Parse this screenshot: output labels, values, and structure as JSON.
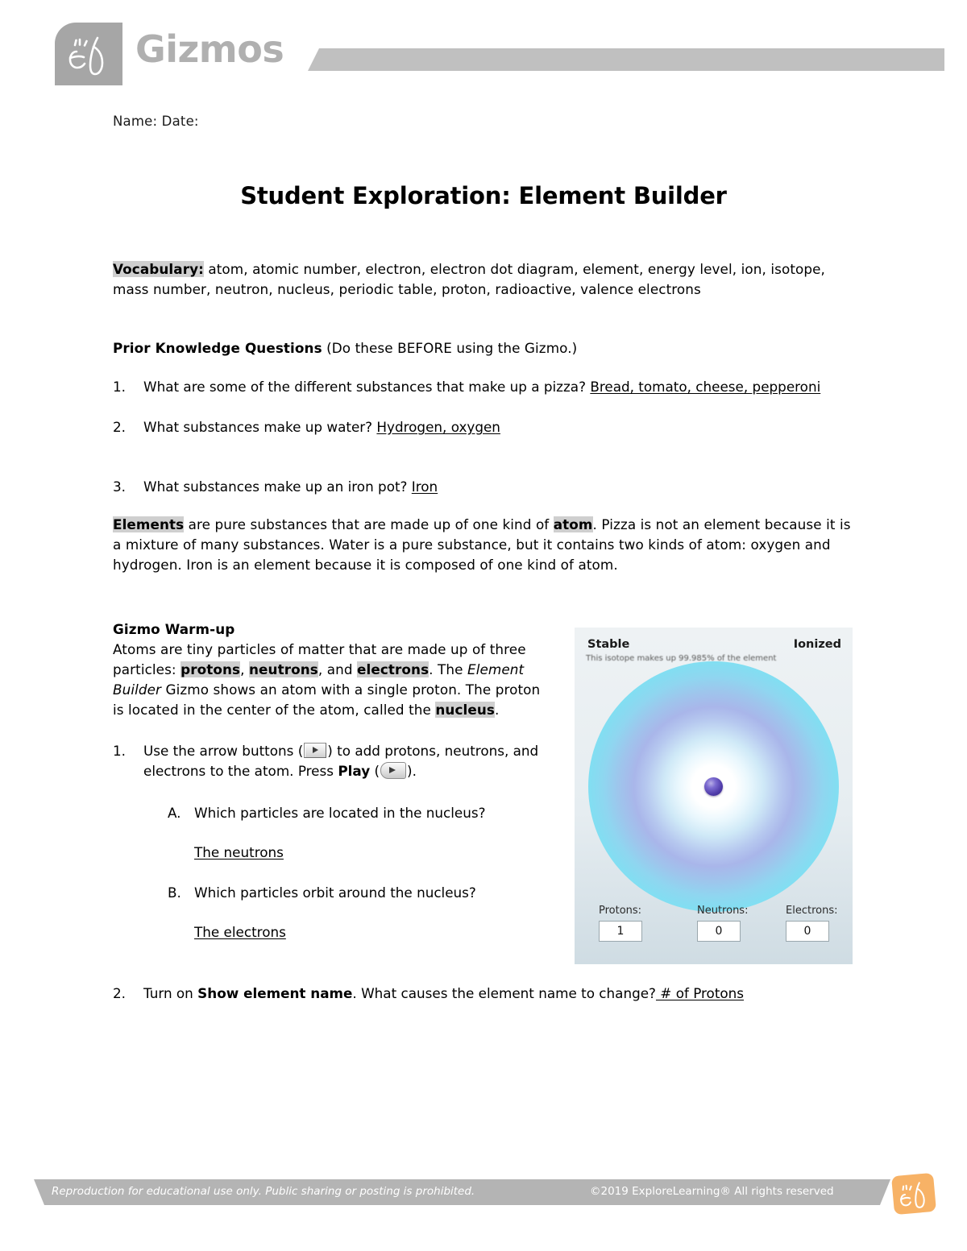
{
  "header": {
    "logo_alt": "ExploreLearning el monogram",
    "wordmark": "Gizmos"
  },
  "document": {
    "name_date_line": "Name: Date:",
    "title": "Student Exploration: Element Builder",
    "vocabulary": {
      "label": "Vocabulary:",
      "terms": " atom, atomic number, electron, electron dot diagram, element, energy level, ion, isotope, mass number, neutron, nucleus, periodic table, proton, radioactive, valence electrons"
    },
    "prior_knowledge": {
      "heading": "Prior Knowledge Questions",
      "heading_note": " (Do these BEFORE using the Gizmo.)",
      "questions": [
        {
          "num": "1.",
          "text": "What are some of the different substances that make up a pizza? ",
          "answer": "Bread, tomato, cheese, pepperoni "
        },
        {
          "num": "2.",
          "text": "What substances make up water? ",
          "answer": "Hydrogen, oxygen"
        },
        {
          "num": "3.",
          "text": "What substances make up an iron pot? ",
          "answer": "Iron"
        }
      ]
    },
    "elements_paragraph": {
      "term_elements": "Elements",
      "part1": " are pure substances that are made up of one kind of ",
      "term_atom": "atom",
      "part2": ". Pizza is not an element because it is a mixture of many substances. Water is a pure substance, but it contains two kinds of atom: oxygen and hydrogen. Iron is an element because it is composed of one kind of atom."
    },
    "warmup": {
      "heading": "Gizmo Warm-up",
      "part1": "Atoms are tiny particles of matter that are made up of three particles: ",
      "term_protons": "protons",
      "sep1": ", ",
      "term_neutrons": "neutrons",
      "sep2": ", and ",
      "term_electrons": "electrons",
      "part2": ". The ",
      "gizmo_name": "Element Builder",
      "part3": " Gizmo shows an atom with a single proton. The proton is located in the center of the atom, called the ",
      "term_nucleus": "nucleus",
      "part4": "."
    },
    "warmup_questions": [
      {
        "num": "1.",
        "text_a": "Use the arrow buttons (",
        "icon_arrow": "arrow-button-icon",
        "text_b": ") to add protons, neutrons, and electrons to the atom. Press ",
        "play_label": "Play",
        "text_c": " (",
        "icon_play": "play-button-icon",
        "text_d": ").",
        "subquestions": [
          {
            "num": "A.",
            "text": "Which particles are located in the nucleus?",
            "answer": "The neutrons"
          },
          {
            "num": "B.",
            "text": "Which particles orbit around the nucleus?",
            "answer": "The electrons"
          }
        ]
      },
      {
        "num": "2.",
        "text_a": "Turn on ",
        "bold_term": "Show element name",
        "text_b": ". What causes the element name to change?",
        "answer": " # of Protons"
      }
    ]
  },
  "gizmo_panel": {
    "stable_label": "Stable",
    "ionized_label": "Ionized",
    "isotope_note": "This isotope makes up 99.985% of the element",
    "controls": [
      {
        "label": "Protons:",
        "value": "1"
      },
      {
        "label": "Neutrons:",
        "value": "0"
      },
      {
        "label": "Electrons:",
        "value": "0"
      }
    ],
    "colors": {
      "proton": "#4e3aa8",
      "outer_shell": "#79e1f1",
      "mid_shell": "#a9b6ea"
    }
  },
  "footer": {
    "left_text": "Reproduction for educational use only. Public sharing or posting is prohibited.",
    "right_text": "©2019 ExploreLearning®  All rights reserved",
    "logo_alt": "ExploreLearning el monogram"
  }
}
